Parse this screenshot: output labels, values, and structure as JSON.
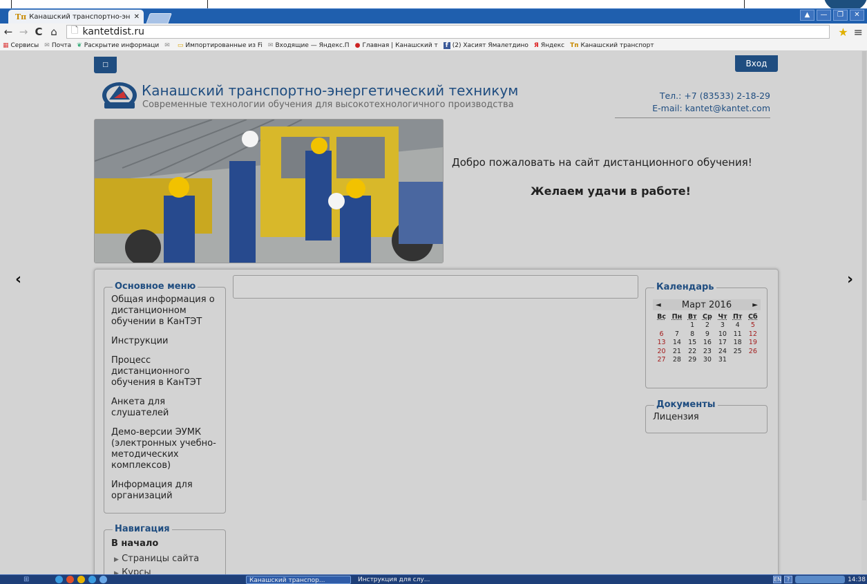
{
  "browser": {
    "tab_title": "Канашский транспортно-эн",
    "tab_close": "✕",
    "tab_favicon": "Тп",
    "url": "kantetdist.ru",
    "window_buttons": [
      "▲",
      "—",
      "❐",
      "✕"
    ],
    "nav_icons": [
      "←",
      "→",
      "C",
      "⌂"
    ],
    "bookmarks": [
      {
        "icon": "grid-icon",
        "label": "Сервисы"
      },
      {
        "icon": "mail-icon",
        "label": "Почта"
      },
      {
        "icon": "leaf-icon",
        "label": "Раскрытие информаци"
      },
      {
        "icon": "mail-icon",
        "label": ""
      },
      {
        "icon": "folder-icon",
        "label": "Импортированные из Fi"
      },
      {
        "icon": "mail-icon",
        "label": "Входящие — Яндекс.П"
      },
      {
        "icon": "site-icon",
        "label": "Главная | Канашский т"
      },
      {
        "icon": "facebook-icon",
        "label": "(2) Хасият Ямалетдино"
      },
      {
        "icon": "yandex-icon",
        "label": "Яндекс"
      },
      {
        "icon": "site-icon",
        "label": "Канашский транспорт"
      }
    ]
  },
  "site": {
    "top_button": "□",
    "login": "Вход",
    "title": "Канашский транспортно-энергетический техникум",
    "subtitle": "Современные технологии обучения для высокотехнологичного производства",
    "phone": "Тел.: +7 (83533) 2-18-29",
    "email": "E-mail: kantet@kantet.com",
    "welcome": "Добро пожаловать на сайт дистанционного обучения!",
    "wish": "Желаем удачи в работе!",
    "arrow_left": "‹",
    "arrow_right": "›"
  },
  "main_menu": {
    "title": "Основное меню",
    "items": [
      "Общая информация о дистанционном обучении в КанТЭТ",
      "Инструкции",
      "Процесс дистанционного обучения в КанТЭТ",
      "Анкета для слушателей",
      "Демо-версии ЭУМК (электронных учебно-методических комплексов)",
      "Информация для организаций"
    ]
  },
  "navigation": {
    "title": "Навигация",
    "home": "В начало",
    "items": [
      "Страницы сайта",
      "Курсы"
    ]
  },
  "calendar": {
    "title": "Календарь",
    "month": "Март 2016",
    "prev": "◄",
    "next": "►",
    "days": [
      "Вс",
      "Пн",
      "Вт",
      "Ср",
      "Чт",
      "Пт",
      "Сб"
    ],
    "weeks": [
      [
        "",
        "",
        "1",
        "2",
        "3",
        "4",
        "5"
      ],
      [
        "6",
        "7",
        "8",
        "9",
        "10",
        "11",
        "12"
      ],
      [
        "13",
        "14",
        "15",
        "16",
        "17",
        "18",
        "19"
      ],
      [
        "20",
        "21",
        "22",
        "23",
        "24",
        "25",
        "26"
      ],
      [
        "27",
        "28",
        "29",
        "30",
        "31",
        "",
        ""
      ]
    ],
    "weekend_color": "#a31d1d"
  },
  "documents": {
    "title": "Документы",
    "items": [
      "Лицензия"
    ]
  },
  "taskbar": {
    "items": [
      "Канашский транспор...",
      "Инструкция для слу..."
    ],
    "lang": "EN",
    "time": "14:38"
  },
  "colors": {
    "accent": "#1f4d80",
    "page_bg": "#d3d3d3",
    "tabbar": "#1f5fae",
    "taskbar": "#1e3f79"
  }
}
